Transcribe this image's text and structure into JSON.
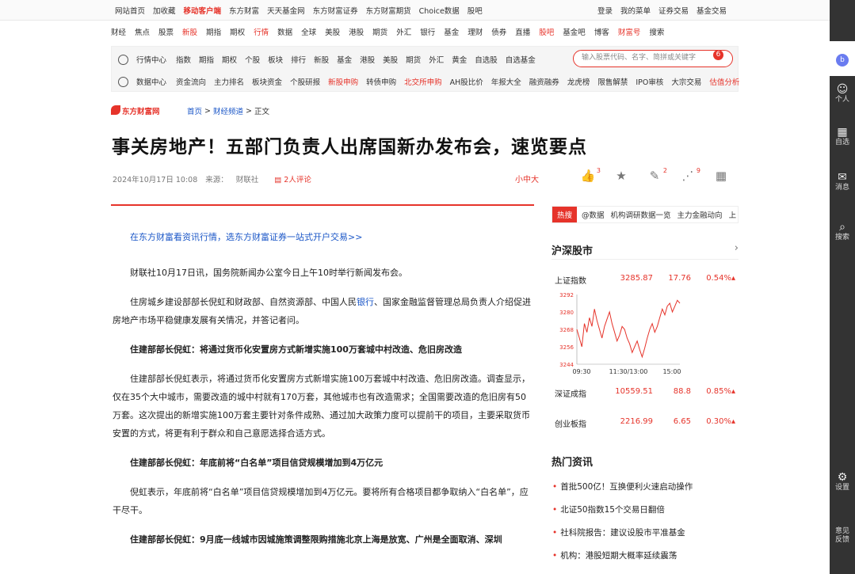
{
  "topbar": {
    "left": [
      "网站首页",
      "加收藏",
      "移动客户端",
      "东方财富",
      "天天基金网",
      "东方财富证券",
      "东方财富期货",
      "Choice数据",
      "股吧"
    ],
    "right": [
      "登录",
      "我的菜单",
      "证券交易",
      "基金交易"
    ]
  },
  "nav2": [
    "财经",
    "焦点",
    "股票",
    "新股",
    "期指",
    "期权",
    "行情",
    "数据",
    "全球",
    "美股",
    "港股",
    "期货",
    "外汇",
    "银行",
    "基金",
    "理财",
    "债券",
    "直播",
    "股吧",
    "基金吧",
    "博客",
    "财富号",
    "搜索"
  ],
  "search": {
    "row1_label": "行情中心",
    "row1": [
      "指数",
      "期指",
      "期权",
      "个股",
      "板块",
      "排行",
      "新股",
      "基金",
      "港股",
      "美股",
      "期货",
      "外汇",
      "黄金",
      "自选股",
      "自选基金"
    ],
    "row2_label": "数据中心",
    "row2": [
      "资金流向",
      "主力排名",
      "板块资金",
      "个股研报",
      "新股申购",
      "转债申购",
      "北交所申购",
      "AH股比价",
      "年报大全",
      "融资融券",
      "龙虎榜",
      "限售解禁",
      "IPO审核",
      "大宗交易",
      "估值分析"
    ],
    "placeholder": "输入股票代码、名字、简拼或关键字",
    "badge": "6"
  },
  "crumb": {
    "logo": "东方财富网",
    "home": "首页",
    "sep": ">",
    "channel": "财经频道",
    "current": "正文"
  },
  "article": {
    "title": "事关房地产！五部门负责人出席国新办发布会，速览要点",
    "date": "2024年10月17日 10:08",
    "source_label": "来源：",
    "source": "财联社",
    "comments": "2人评论",
    "fontsize": "小中大",
    "actions": {
      "like": "3",
      "fav": "",
      "comment": "2",
      "share": "9"
    },
    "promo": "在东方财富看资讯行情，选东方财富证券一站式开户交易>>",
    "p1": "财联社10月17日讯，国务院新闻办公室今日上午10时举行新闻发布会。",
    "p2a": "住房城乡建设部部长倪虹和财政部、自然资源部、中国人民",
    "p2link": "银行",
    "p2b": "、国家金融监督管理总局负责人介绍促进房地产市场平稳健康发展有关情况，并答记者问。",
    "h1": "住建部部长倪虹：将通过货币化安置房方式新增实施100万套城中村改造、危旧房改造",
    "p3": "住建部部长倪虹表示，将通过货币化安置房方式新增实施100万套城中村改造、危旧房改造。调查显示，仅在35个大中城市，需要改造的城中村就有170万套，其他城市也有改造需求；全国需要改造的危旧房有50万套。这次提出的新增实施100万套主要针对条件成熟、通过加大政策力度可以提前干的项目，主要采取货币安置的方式，将更有利于群众和自己意愿选择合适方式。",
    "h2": "住建部部长倪虹：年底前将“白名单”项目信贷规模增加到4万亿元",
    "p4": "倪虹表示，年底前将“白名单”项目信贷规模增加到4万亿元。要将所有合格项目都争取纳入“白名单”，应干尽干。",
    "h3": "住建部部长倪虹：9月底一线城市因城施策调整限购措施北京上海是放宽、广州是全面取消、深圳"
  },
  "side": {
    "hot_tag": "热搜",
    "hot_items": [
      "@数据",
      "机构调研数据一览",
      "主力金融动向",
      "上"
    ],
    "market_title": "沪深股市",
    "indices": [
      {
        "name": "上证指数",
        "value": "3285.87",
        "change": "17.76",
        "pct": "0.54%"
      },
      {
        "name": "深证成指",
        "value": "10559.51",
        "change": "88.8",
        "pct": "0.85%"
      },
      {
        "name": "创业板指",
        "value": "2216.99",
        "change": "6.65",
        "pct": "0.30%"
      }
    ],
    "hot_title": "热门资讯",
    "news": [
      "首批500亿！互换便利火速启动操作",
      "北证50指数15个交易日翻倍",
      "社科院报告：建议设股市平准基金",
      "机构：港股短期大概率延续震荡"
    ]
  },
  "chart_data": {
    "type": "line",
    "x_ticks": [
      "09:30",
      "11:30/13:00",
      "15:00"
    ],
    "y_ticks": [
      "3292",
      "3280",
      "3268",
      "3256",
      "3244"
    ],
    "ylim": [
      3244,
      3292
    ],
    "values": [
      3268,
      3262,
      3256,
      3272,
      3266,
      3276,
      3270,
      3282,
      3274,
      3268,
      3262,
      3270,
      3275,
      3280,
      3272,
      3266,
      3260,
      3264,
      3270,
      3268,
      3262,
      3258,
      3252,
      3256,
      3260,
      3254,
      3249,
      3255,
      3262,
      3268,
      3272,
      3266,
      3270,
      3276,
      3282,
      3278,
      3284,
      3286,
      3280,
      3284,
      3288,
      3286
    ]
  },
  "rail": [
    "个人",
    "自选",
    "消息",
    "搜索",
    "设置",
    "意见反馈"
  ],
  "colors": {
    "accent": "#e6332a",
    "link": "#1a56c7"
  }
}
